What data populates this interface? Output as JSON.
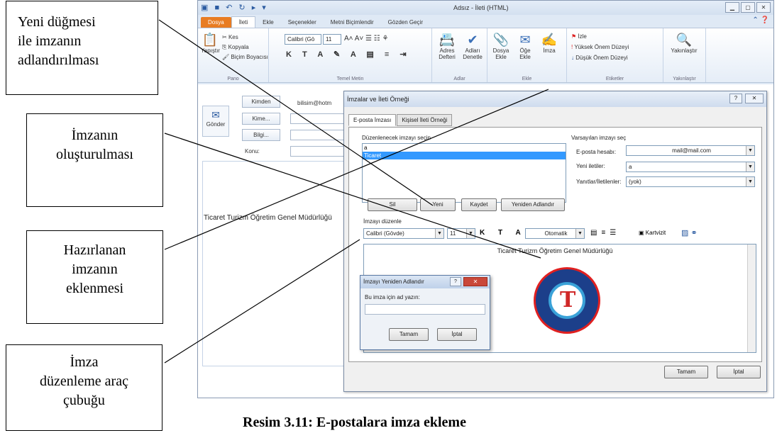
{
  "callouts": {
    "c1": [
      "Yeni düğmesi",
      "ile imzanın",
      "adlandırılması"
    ],
    "c2": [
      "İmzanın",
      "oluşturulması"
    ],
    "c3": [
      "Hazırlanan",
      "imzanın",
      "eklenmesi"
    ],
    "c4": [
      "İmza",
      "düzenleme araç",
      "çubuğu"
    ]
  },
  "caption": "Resim 3.11: E-postalara imza ekleme",
  "window": {
    "title": "Adsız - İleti (HTML)",
    "tabs": [
      "Dosya",
      "İleti",
      "Ekle",
      "Seçenekler",
      "Metni Biçimlendir",
      "Gözden Geçir"
    ],
    "ribbon": {
      "pano": {
        "label": "Pano",
        "items": [
          "Yapıştır",
          "Kes",
          "Kopyala",
          "Biçim Boyacısı"
        ]
      },
      "temel_metin": {
        "label": "Temel Metin",
        "font": "Calibri (Gö",
        "size": "11"
      },
      "adlar": {
        "label": "Adlar",
        "items": [
          "Adres Defteri",
          "Adları Denetle"
        ]
      },
      "ekle": {
        "label": "Ekle",
        "items": [
          "Dosya Ekle",
          "Öğe Ekle",
          "İmza"
        ]
      },
      "etiketler": {
        "label": "Etiketler",
        "items": [
          "İzle",
          "Yüksek Önem Düzeyi",
          "Düşük Önem Düzeyi"
        ]
      },
      "yakinlastir": {
        "label": "Yakınlaştır",
        "item": "Yakınlaştır"
      }
    },
    "compose": {
      "send": "Gönder",
      "from": "Kimden",
      "from_addr": "bilisim@hotm",
      "to": "Kime...",
      "cc": "Bilgi...",
      "subject": "Konu:",
      "body_text": "Ticaret Turizm Öğretim Genel Müdürlüğü"
    }
  },
  "dialog": {
    "title": "İmzalar ve İleti Örneği",
    "tabs": [
      "E-posta İmzası",
      "Kişisel İleti Örneği"
    ],
    "select_label": "Düzenlenecek imzayı seçin",
    "signatures": [
      "a",
      "Ticaret"
    ],
    "buttons": {
      "delete": "Sil",
      "new": "Yeni",
      "save": "Kaydet",
      "rename": "Yeniden Adlandır"
    },
    "defaults_label": "Varsayılan imzayı seç",
    "email_account_label": "E-posta hesabı:",
    "email_account_value": "mail@mail.com",
    "new_messages_label": "Yeni iletiler:",
    "new_messages_value": "a",
    "replies_label": "Yanıtlar/İletilenler:",
    "replies_value": "(yok)",
    "edit_label": "İmzayı düzenle",
    "font": "Calibri (Gövde)",
    "size": "11",
    "color": "Otomatik",
    "business_card": "Kartvizit",
    "signature_text": "Ticaret Turizm Öğretim Genel Müdürlüğü",
    "ok": "Tamam",
    "cancel": "İptal"
  },
  "rename_dialog": {
    "title": "İmzayı Yeniden Adlandır",
    "prompt": "Bu imza için ad yazın:",
    "ok": "Tamam",
    "cancel": "İptal"
  }
}
